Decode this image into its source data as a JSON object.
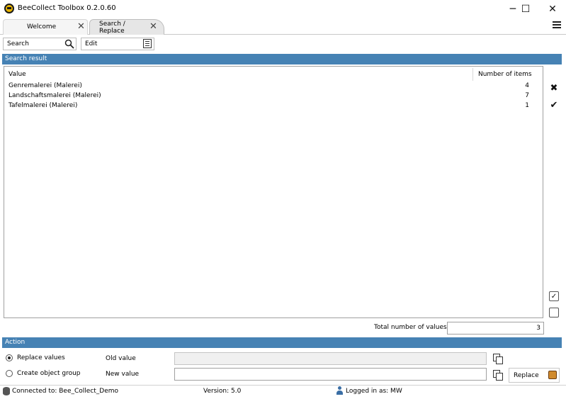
{
  "window": {
    "title": "BeeCollect Toolbox 0.2.0.60",
    "minimize": "─",
    "maximize": "☐",
    "close": "✕"
  },
  "tabs": [
    {
      "label": "Welcome",
      "active": false
    },
    {
      "label": "Search / Replace",
      "active": true
    }
  ],
  "toolbar": {
    "search_label": "Search",
    "edit_label": "Edit"
  },
  "search_result": {
    "header": "Search result",
    "columns": [
      "Value",
      "Number of items"
    ],
    "rows": [
      {
        "value": "Genremalerei (Malerei)",
        "count": "4"
      },
      {
        "value": "Landschaftsmalerei (Malerei)",
        "count": "7"
      },
      {
        "value": "Tafelmalerei (Malerei)",
        "count": "1"
      }
    ],
    "total_label": "Total number of values",
    "total_value": "3"
  },
  "action": {
    "header": "Action",
    "options": [
      {
        "label": "Replace values",
        "selected": true
      },
      {
        "label": "Create object group",
        "selected": false
      }
    ],
    "old_value_label": "Old value",
    "old_value": "",
    "new_value_label": "New value",
    "new_value": "",
    "replace_label": "Replace"
  },
  "status": {
    "connection": "Connected to: Bee_Collect_Demo",
    "version": "Version: 5.0",
    "user": "Logged in as: MW"
  },
  "colors": {
    "section_bar": "#4682b4",
    "accent_icon": "#e8b400"
  },
  "icons": {
    "app": "bee-logo-icon",
    "search": "magnifier-icon",
    "edit": "list-icon",
    "clear": "x-icon",
    "confirm": "checkmark-icon",
    "check_all": "checked-box-icon",
    "uncheck_all": "empty-box-icon",
    "copy": "copy-icon",
    "replace": "replace-image-icon",
    "database": "database-icon",
    "user": "user-icon"
  }
}
